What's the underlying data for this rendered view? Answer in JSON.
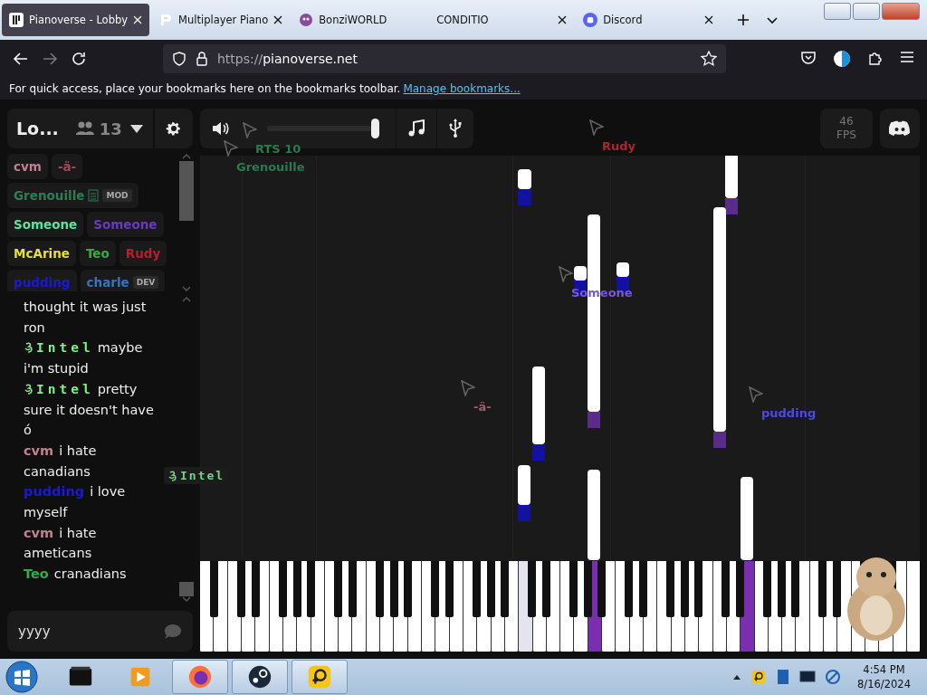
{
  "browser": {
    "tabs": [
      {
        "title": "Pianoverse - Lobby",
        "selected": true,
        "kind": "piano",
        "closable": true
      },
      {
        "title": "Multiplayer Piano",
        "selected": false,
        "kind": "mpp",
        "closable": true
      },
      {
        "title": "BonziWORLD",
        "selected": false,
        "kind": "bonzi",
        "closable": false
      },
      {
        "title": "CONDITIO",
        "selected": false,
        "kind": "none",
        "closable": true
      },
      {
        "title": "Discord",
        "selected": false,
        "kind": "discord",
        "closable": true
      }
    ],
    "url_prefix": "https://",
    "url_host": "pianoverse.net",
    "bookmarks_hint": "For quick access, place your bookmarks here on the bookmarks toolbar.",
    "bookmarks_link": "Manage bookmarks..."
  },
  "room": {
    "name": "Lo...",
    "count": "13"
  },
  "users": [
    {
      "name": "cvm",
      "color": "#c07f92"
    },
    {
      "name": "-ä-",
      "color": "#9a4a5c"
    },
    {
      "name": "Grenouille",
      "color": "#2f7d56",
      "tag": "MOD",
      "badge": true
    },
    {
      "name": "Someone",
      "color": "#5fe3a1"
    },
    {
      "name": "Someone",
      "color": "#6a3bbd"
    },
    {
      "name": "McArine",
      "color": "#e6e03a"
    },
    {
      "name": "Teo",
      "color": "#3aa84a"
    },
    {
      "name": "Rudy",
      "color": "#b3202e"
    },
    {
      "name": "pudding",
      "color": "#1a1ad6"
    },
    {
      "name": "charle",
      "color": "#3a72c2",
      "tag": "DEV"
    }
  ],
  "chat": [
    {
      "kind": "plain",
      "text": "thought it was just ron"
    },
    {
      "kind": "intel",
      "name": "Intel",
      "color": "#7ef08a",
      "text": "maybe i'm stupid"
    },
    {
      "kind": "intel",
      "name": "Intel",
      "color": "#7ef08a",
      "text": "pretty sure it doesn't have ó"
    },
    {
      "kind": "user",
      "name": "cvm",
      "color": "#c07f92",
      "text": "i hate canadians"
    },
    {
      "kind": "user",
      "name": "pudding",
      "color": "#1a1ad6",
      "text": "i love myself"
    },
    {
      "kind": "user",
      "name": "cvm",
      "color": "#c07f92",
      "text": "i hate ameticans"
    },
    {
      "kind": "user",
      "name": "Teo",
      "color": "#3aa84a",
      "text": "cranadians"
    }
  ],
  "tooltip": "Intel",
  "chat_input": {
    "value": "yyyy"
  },
  "toolbar": {
    "volume": {
      "level": 1.0
    },
    "fps": "46",
    "fps_label": "FPS"
  },
  "cursors": [
    {
      "name": "RTS 10",
      "color": "#2a7a50"
    },
    {
      "name": "Grenouille",
      "color": "#2a7a50"
    },
    {
      "name": "Rudy",
      "color": "#b02432"
    },
    {
      "name": "Someone",
      "color": "#7a5ad0"
    },
    {
      "name": "-ä-",
      "color": "#9a6070"
    },
    {
      "name": "pudding",
      "color": "#4a4ae8"
    }
  ],
  "white_keys": [
    {
      "pressed": false
    },
    {
      "pressed": false
    },
    {
      "pressed": false
    },
    {
      "pressed": false
    },
    {
      "pressed": false
    },
    {
      "pressed": false
    },
    {
      "pressed": false
    },
    {
      "pressed": false
    },
    {
      "pressed": false
    },
    {
      "pressed": false
    },
    {
      "pressed": false
    },
    {
      "pressed": false
    },
    {
      "pressed": false
    },
    {
      "pressed": false
    },
    {
      "pressed": false
    },
    {
      "pressed": false
    },
    {
      "pressed": false
    },
    {
      "pressed": false
    },
    {
      "pressed": false
    },
    {
      "pressed": false
    },
    {
      "pressed": false
    },
    {
      "pressed": false
    },
    {
      "pressed": false
    },
    {
      "pressed": true,
      "color": "#e4e4ee"
    },
    {
      "pressed": false
    },
    {
      "pressed": false
    },
    {
      "pressed": false
    },
    {
      "pressed": false
    },
    {
      "pressed": true,
      "color": "#7a2fb0"
    },
    {
      "pressed": false
    },
    {
      "pressed": false
    },
    {
      "pressed": false
    },
    {
      "pressed": false
    },
    {
      "pressed": false
    },
    {
      "pressed": false
    },
    {
      "pressed": false
    },
    {
      "pressed": false
    },
    {
      "pressed": false
    },
    {
      "pressed": false
    },
    {
      "pressed": true,
      "color": "#7a2fb0"
    },
    {
      "pressed": false
    },
    {
      "pressed": false
    },
    {
      "pressed": false
    },
    {
      "pressed": false
    },
    {
      "pressed": false
    },
    {
      "pressed": false
    },
    {
      "pressed": false
    },
    {
      "pressed": false
    },
    {
      "pressed": false
    },
    {
      "pressed": false
    },
    {
      "pressed": false
    },
    {
      "pressed": false
    }
  ],
  "taskbar": {
    "apps": [
      {
        "kind": "folder",
        "running": false
      },
      {
        "kind": "media",
        "running": false
      },
      {
        "kind": "firefox",
        "running": true
      },
      {
        "kind": "steam",
        "running": true
      },
      {
        "kind": "parsec",
        "running": true
      }
    ],
    "time": "4:54 PM",
    "date": "8/16/2024"
  }
}
